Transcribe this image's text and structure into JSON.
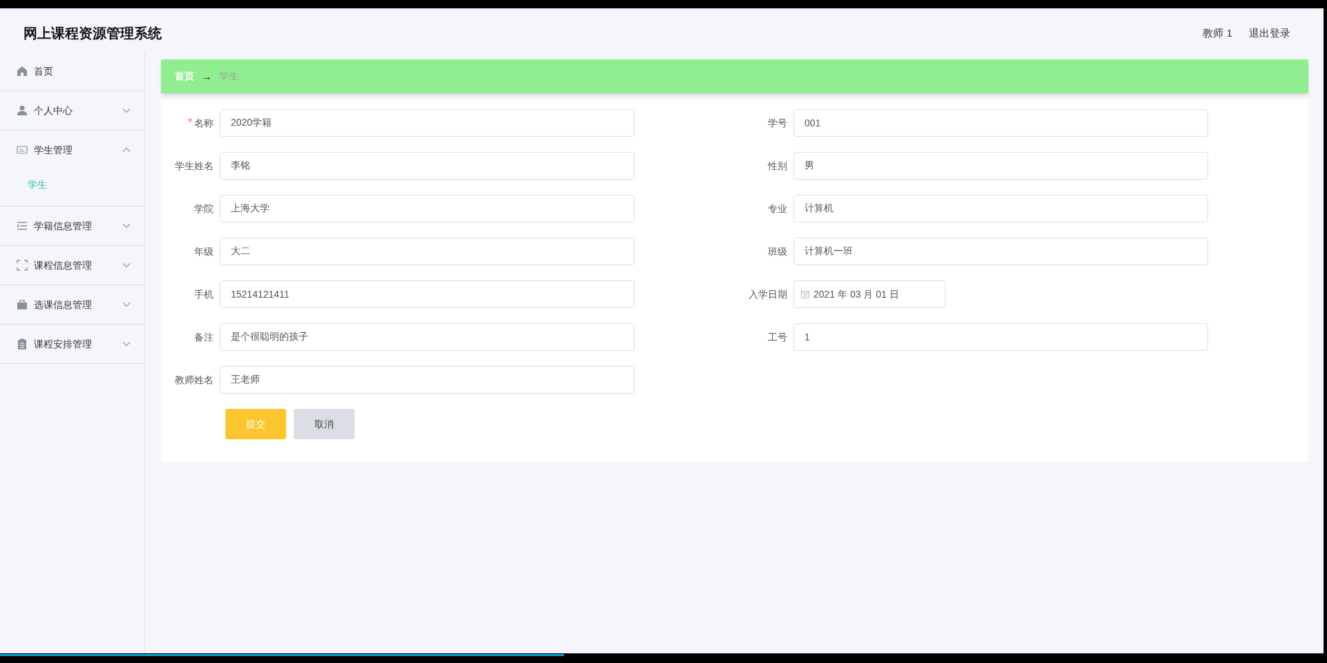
{
  "header": {
    "title": "网上课程资源管理系统",
    "user": "教师 1",
    "logout": "退出登录"
  },
  "sidebar": {
    "items": [
      {
        "label": "首页"
      },
      {
        "label": "个人中心",
        "expanded": false
      },
      {
        "label": "学生管理",
        "expanded": true,
        "children": [
          {
            "label": "学生",
            "selected": true
          }
        ]
      },
      {
        "label": "学籍信息管理",
        "expanded": false
      },
      {
        "label": "课程信息管理",
        "expanded": false
      },
      {
        "label": "选课信息管理",
        "expanded": false
      },
      {
        "label": "课程安排管理",
        "expanded": false
      }
    ]
  },
  "breadcrumb": {
    "home": "首页",
    "separator": "→",
    "current": "学生"
  },
  "form": {
    "fields": [
      {
        "label": "名称",
        "value": "2020学籍",
        "required_mark": "*",
        "kind": "text"
      },
      {
        "label": "学号",
        "value": "001",
        "kind": "text"
      },
      {
        "label": "学生姓名",
        "value": "李铭",
        "kind": "text"
      },
      {
        "label": "性别",
        "value": "男",
        "kind": "text"
      },
      {
        "label": "学院",
        "value": "上海大学",
        "kind": "text"
      },
      {
        "label": "专业",
        "value": "计算机",
        "kind": "text"
      },
      {
        "label": "年级",
        "value": "大二",
        "kind": "text"
      },
      {
        "label": "班级",
        "value": "计算机一班",
        "kind": "text"
      },
      {
        "label": "手机",
        "value": "15214121411",
        "kind": "text"
      },
      {
        "label": "入学日期",
        "value": "2021 年 03 月 01 日",
        "kind": "date"
      },
      {
        "label": "备注",
        "value": "是个很聪明的孩子",
        "kind": "text"
      },
      {
        "label": "工号",
        "value": "1",
        "kind": "text"
      },
      {
        "label": "教师姓名",
        "value": "王老师",
        "kind": "text"
      }
    ],
    "buttons": [
      {
        "label": "提交",
        "kind": "primary"
      },
      {
        "label": "取消",
        "kind": "secondary"
      }
    ]
  },
  "player": {
    "level": 0.425
  }
}
